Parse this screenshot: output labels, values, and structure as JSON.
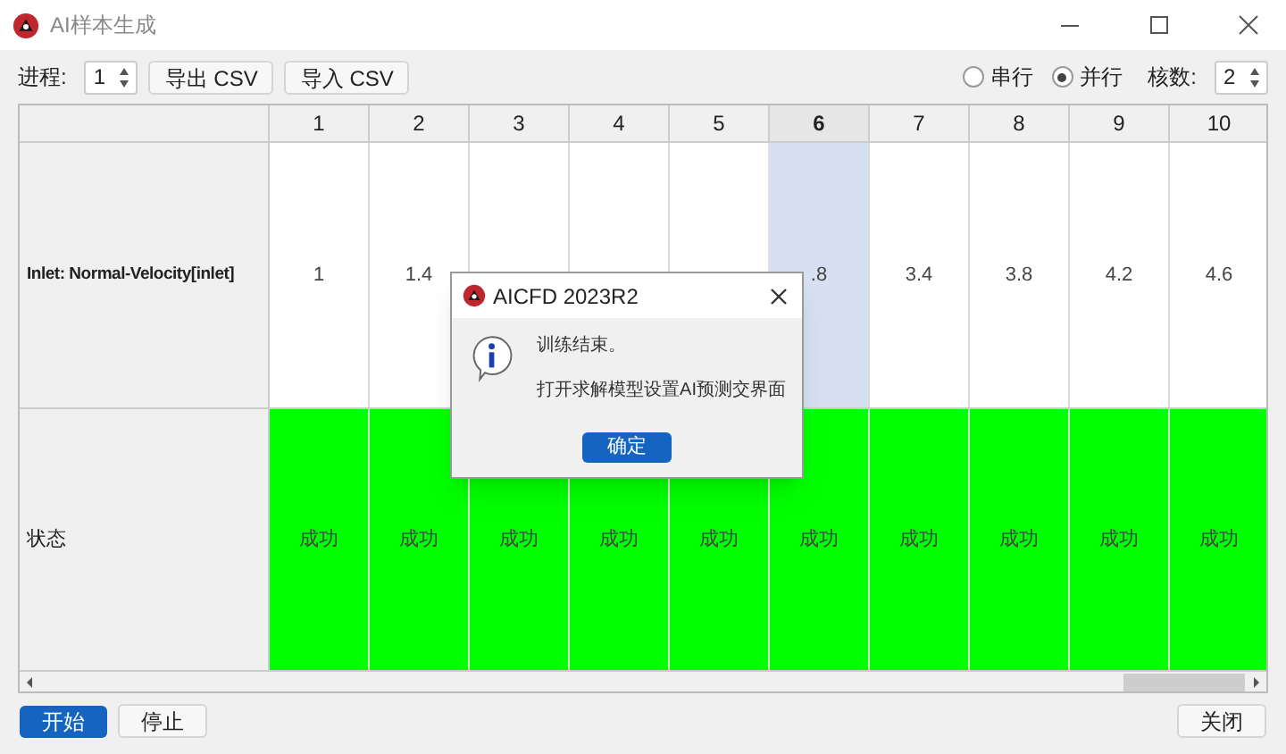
{
  "window": {
    "title": "AI样本生成"
  },
  "toolbar": {
    "process_label": "进程:",
    "process_value": "1",
    "export_button": "导出 CSV",
    "import_button": "导入 CSV",
    "modes": [
      {
        "label": "串行",
        "selected": false
      },
      {
        "label": "并行",
        "selected": true
      }
    ],
    "cores_label": "核数:",
    "cores_value": "2"
  },
  "table": {
    "columns": [
      {
        "label": "1",
        "selected": false
      },
      {
        "label": "2",
        "selected": false
      },
      {
        "label": "3",
        "selected": false
      },
      {
        "label": "4",
        "selected": false
      },
      {
        "label": "5",
        "selected": false
      },
      {
        "label": "6",
        "selected": true
      },
      {
        "label": "7",
        "selected": false
      },
      {
        "label": "8",
        "selected": false
      },
      {
        "label": "9",
        "selected": false
      },
      {
        "label": "10",
        "selected": false
      }
    ],
    "rows": [
      {
        "kind": "value",
        "header": "Inlet: Normal-Velocity[inlet]",
        "cells": [
          {
            "text": "1"
          },
          {
            "text": "1.4"
          },
          {},
          {},
          {},
          {
            "text": ".8"
          },
          {
            "text": "3.4"
          },
          {
            "text": "3.8"
          },
          {
            "text": "4.2"
          },
          {
            "text": "4.6"
          }
        ]
      },
      {
        "kind": "status",
        "header": "状态",
        "cells": [
          {
            "text": "成功",
            "color": "#00ff00"
          },
          {
            "text": "成功",
            "color": "#00ff00"
          },
          {
            "text": "成功",
            "color": "#00ff00"
          },
          {
            "text": "成功",
            "color": "#00ff00"
          },
          {
            "text": "成功",
            "color": "#00ff00"
          },
          {
            "text": "成功",
            "color": "#00ff00"
          },
          {
            "text": "成功",
            "color": "#00ff00"
          },
          {
            "text": "成功",
            "color": "#00ff00"
          },
          {
            "text": "成功",
            "color": "#00ff00"
          },
          {
            "text": "成功",
            "color": "#00ff00"
          }
        ]
      }
    ]
  },
  "buttons": {
    "start": "开始",
    "stop": "停止",
    "close": "关闭"
  },
  "dialog": {
    "title": "AICFD 2023R2",
    "lines": [
      "训练结束。",
      "打开求解模型设置AI预测交界面"
    ],
    "ok": "确定"
  }
}
